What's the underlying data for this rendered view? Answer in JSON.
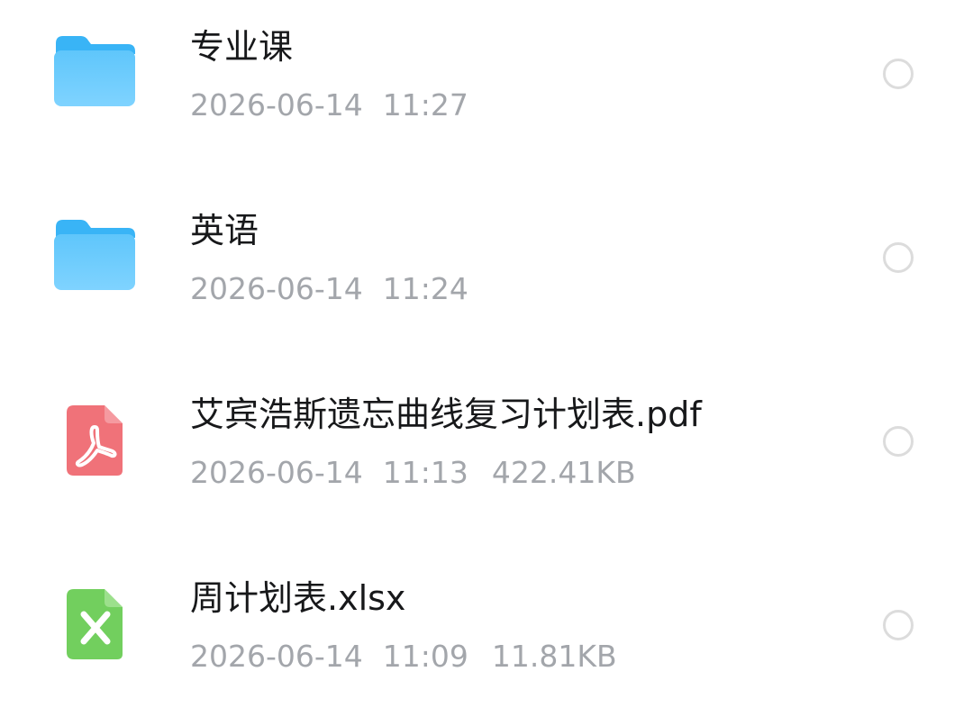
{
  "files": [
    {
      "name": "专业课",
      "type": "folder",
      "icon": "folder-icon",
      "date": "2026-06-14",
      "time": "11:27",
      "size": "",
      "selected": false
    },
    {
      "name": "英语",
      "type": "folder",
      "icon": "folder-icon",
      "date": "2026-06-14",
      "time": "11:24",
      "size": "",
      "selected": false
    },
    {
      "name": "艾宾浩斯遗忘曲线复习计划表.pdf",
      "type": "pdf",
      "icon": "pdf-file-icon",
      "date": "2026-06-14",
      "time": "11:13",
      "size": "422.41KB",
      "selected": false
    },
    {
      "name": "周计划表.xlsx",
      "type": "xlsx",
      "icon": "excel-file-icon",
      "date": "2026-06-14",
      "time": "11:09",
      "size": "11.81KB",
      "selected": false
    }
  ],
  "colors": {
    "folder_light": "#7fd3ff",
    "folder_dark": "#39b4f6",
    "pdf": "#f07279",
    "excel": "#72cf5e",
    "name_text": "#17181a",
    "meta_text": "#a3a6ab",
    "radio_border": "#dcdcdc"
  }
}
